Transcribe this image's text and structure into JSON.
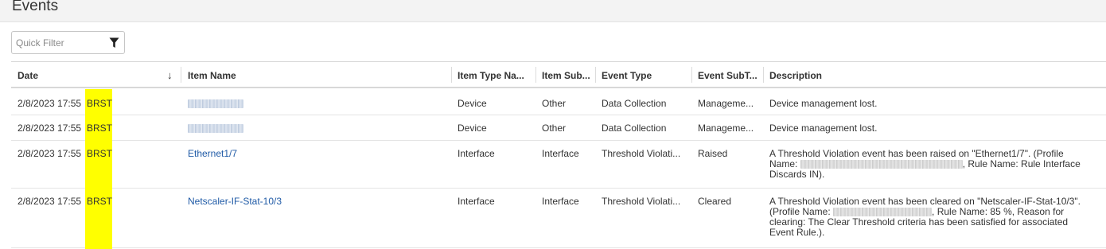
{
  "page": {
    "title": "Events"
  },
  "filter": {
    "placeholder": "Quick Filter",
    "icon": "filter-icon"
  },
  "columns": [
    {
      "label": "Date"
    },
    {
      "label": "Item Name"
    },
    {
      "label": "Item Type Na..."
    },
    {
      "label": "Item Sub..."
    },
    {
      "label": "Event Type"
    },
    {
      "label": "Event SubT..."
    },
    {
      "label": "Description"
    }
  ],
  "sort": {
    "column": "Date",
    "direction": "descending",
    "icon": "arrow-down-icon"
  },
  "highlight_color": "#ffff00",
  "link_color": "#1f5aa6",
  "rows": [
    {
      "date": "2/8/2023 17:55",
      "tz": "BRST",
      "item_name": "",
      "item_type": "Device",
      "item_sub": "Other",
      "event_type": "Data Collection",
      "event_sub": "Manageme...",
      "description": "Device management lost."
    },
    {
      "date": "2/8/2023 17:55",
      "tz": "BRST",
      "item_name": "",
      "item_type": "Device",
      "item_sub": "Other",
      "event_type": "Data Collection",
      "event_sub": "Manageme...",
      "description": "Device management lost."
    },
    {
      "date": "2/8/2023 17:55",
      "tz": "BRST",
      "item_name": "Ethernet1/7",
      "item_type": "Interface",
      "item_sub": "Interface",
      "event_type": "Threshold Violati...",
      "event_sub": "Raised",
      "description_parts": [
        "A Threshold Violation event has been raised on \"Ethernet1/7\". (Profile Name: ",
        ", Rule Name: Rule Interface Discards IN)."
      ]
    },
    {
      "date": "2/8/2023 17:55",
      "tz": "BRST",
      "item_name": "Netscaler-IF-Stat-10/3",
      "item_type": "Interface",
      "item_sub": "Interface",
      "event_type": "Threshold Violati...",
      "event_sub": "Cleared",
      "description_parts": [
        "A Threshold Violation event has been cleared on \"Netscaler-IF-Stat-10/3\". (Profile Name: ",
        ", Rule Name: 85 %, Reason for clearing: The Clear Threshold criteria has been satisfied for associated Event Rule.)."
      ]
    }
  ]
}
